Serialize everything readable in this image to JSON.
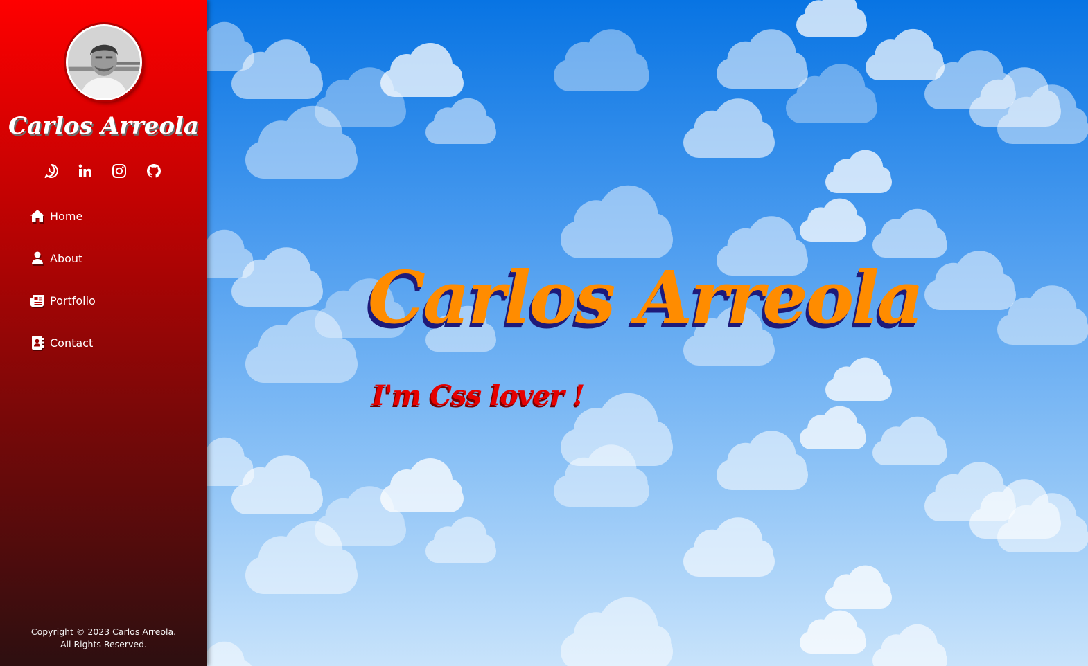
{
  "sidebar": {
    "name": "Carlos Arreola",
    "socials": [
      {
        "icon": "whatsapp-icon"
      },
      {
        "icon": "linkedin-icon"
      },
      {
        "icon": "instagram-icon"
      },
      {
        "icon": "github-icon"
      }
    ],
    "nav": [
      {
        "label": "Home",
        "icon": "home-icon"
      },
      {
        "label": "About",
        "icon": "user-icon"
      },
      {
        "label": "Portfolio",
        "icon": "newspaper-icon"
      },
      {
        "label": "Contact",
        "icon": "address-book-icon"
      }
    ],
    "footer": {
      "line1": "Copyright © 2023 Carlos Arreola.",
      "line2": "All Rights Reserved."
    }
  },
  "hero": {
    "title": "Carlos Arreola",
    "subtitle": "I'm Css lover !"
  },
  "colors": {
    "sidebar_top": "#fe0000",
    "sidebar_bottom": "#2d0f10",
    "sky_top": "#0874e3",
    "sky_bottom": "#c8e3fb",
    "title_fill": "#ff8c00",
    "title_shadow": "#1e1a7a",
    "subtitle_fill": "#e60000"
  }
}
